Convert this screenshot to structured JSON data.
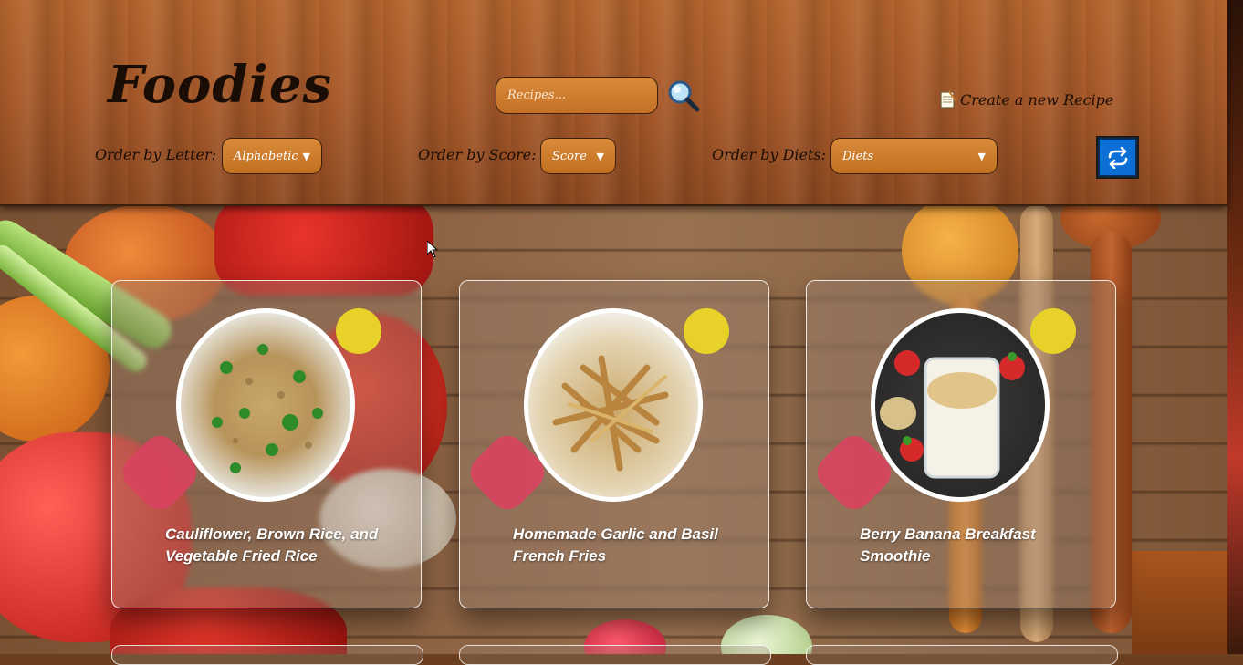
{
  "app": {
    "logo": "Foodies"
  },
  "search": {
    "placeholder": "Recipes..."
  },
  "header": {
    "create_label": "Create a new Recipe"
  },
  "filters": {
    "letter": {
      "label": "Order by Letter:",
      "value": "Alphabetic"
    },
    "score": {
      "label": "Order by Score:",
      "value": "Score"
    },
    "diets": {
      "label": "Order by Diets:",
      "value": "Diets"
    }
  },
  "icons": {
    "search": "magnifier-icon",
    "create": "notepad-icon",
    "refresh": "refresh-icon"
  },
  "colors": {
    "accent_blue": "#0b6fd6",
    "badge_yellow": "#e8d22a",
    "badge_pink": "#d9445f"
  },
  "recipes": [
    {
      "title": "Cauliflower, Brown Rice, and Vegetable Fried Rice"
    },
    {
      "title": "Homemade Garlic and Basil French Fries"
    },
    {
      "title": "Berry Banana Breakfast Smoothie"
    }
  ]
}
